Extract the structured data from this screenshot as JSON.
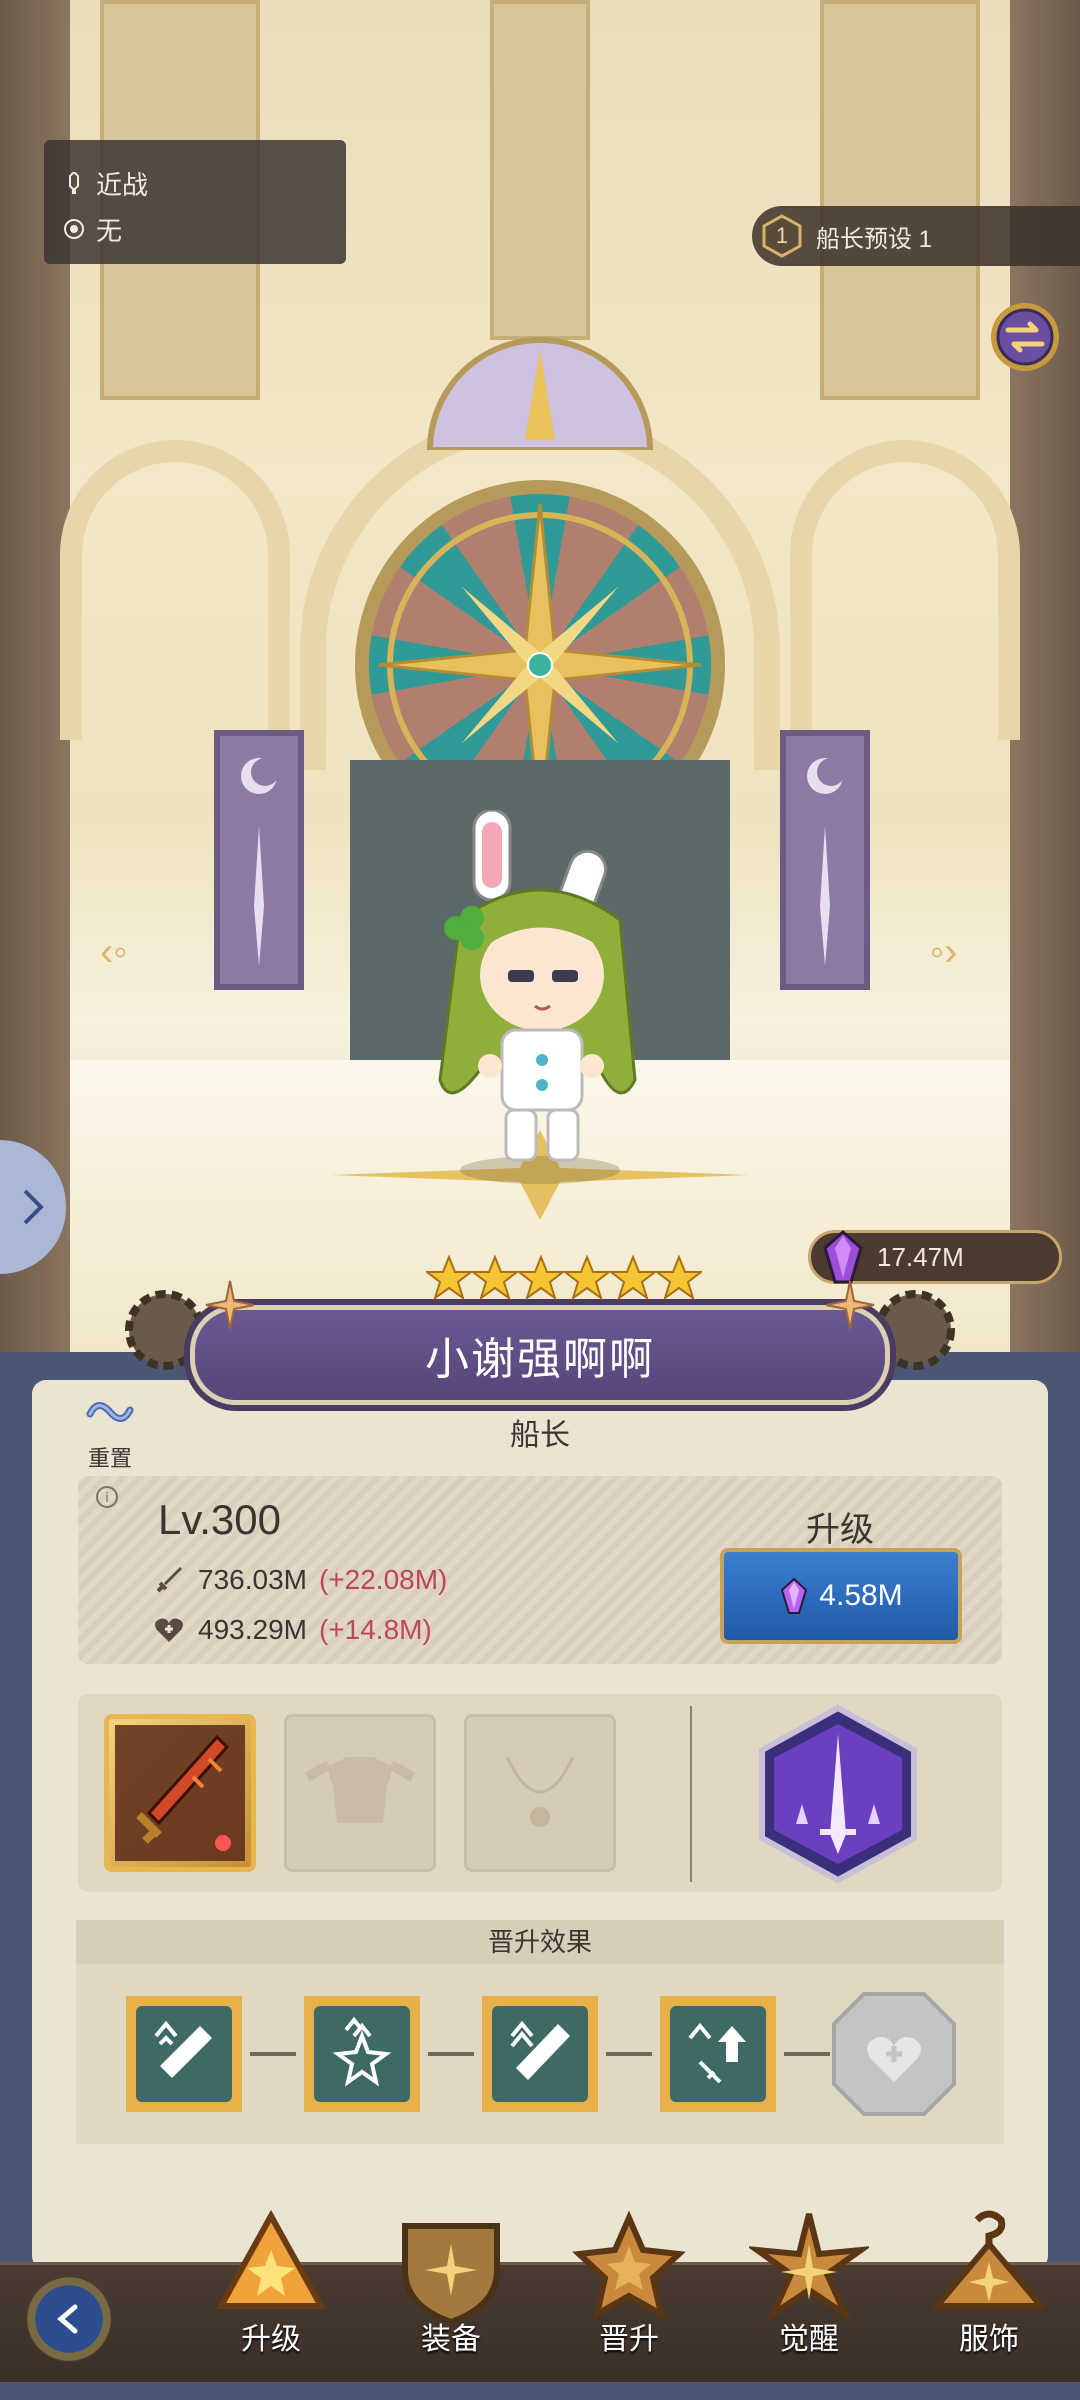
{
  "character": {
    "combat_type": "近战",
    "element": "无",
    "preset_number": "1",
    "preset_label": "船长预设 1",
    "name": "小谢强啊啊",
    "star_count": 6,
    "role": "船长"
  },
  "currency": {
    "amount": "17.47M"
  },
  "panel": {
    "reset_label": "重置",
    "level": "Lv.300",
    "attack_value": "736.03M",
    "attack_bonus": "(+22.08M)",
    "hp_value": "493.29M",
    "hp_bonus": "(+14.8M)",
    "upgrade_title": "升级",
    "upgrade_cost": "4.58M",
    "promotion_title": "晋升效果"
  },
  "nav": {
    "items": [
      {
        "label": "升级",
        "icon": "upgrade-icon"
      },
      {
        "label": "装备",
        "icon": "equipment-icon"
      },
      {
        "label": "晋升",
        "icon": "promotion-icon"
      },
      {
        "label": "觉醒",
        "icon": "awaken-icon"
      },
      {
        "label": "服饰",
        "icon": "costume-icon"
      }
    ]
  },
  "colors": {
    "accent_purple": "#564579",
    "upgrade_blue": "#1f5aa8",
    "bonus_red": "#c0455a",
    "panel_bg": "#ece4d2"
  }
}
